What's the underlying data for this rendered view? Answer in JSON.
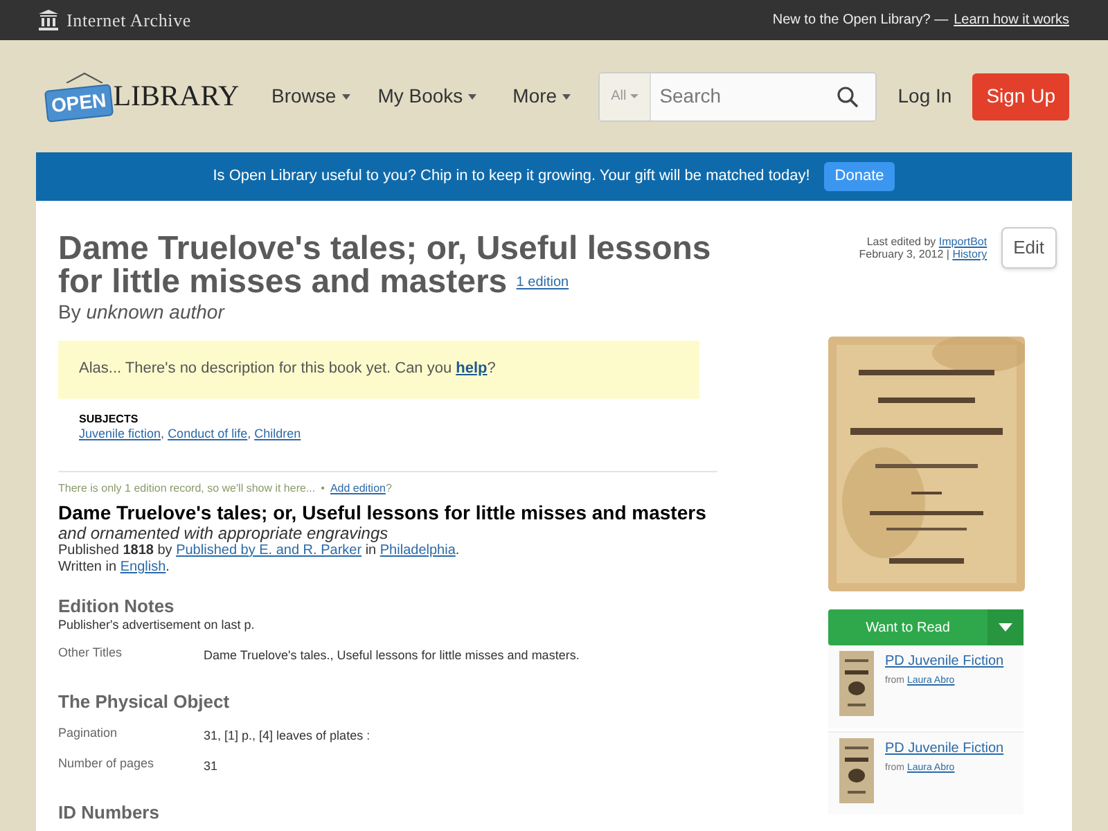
{
  "top_bar": {
    "brand": "Internet Archive",
    "prompt": "New to the Open Library? —",
    "link": "Learn how it works"
  },
  "header": {
    "logo": {
      "badge": "OPEN",
      "word": "LIBRARY"
    },
    "nav": [
      {
        "label": "Browse"
      },
      {
        "label": "My Books"
      },
      {
        "label": "More"
      }
    ],
    "search": {
      "scope": "All",
      "placeholder": "Search"
    },
    "login": "Log In",
    "signup": "Sign Up"
  },
  "banner": {
    "message": "Is Open Library useful to you? Chip in to keep it growing. Your gift will be matched today!",
    "button": "Donate"
  },
  "work": {
    "title": "Dame Truelove's tales; or, Useful lessons for little misses and masters",
    "editions_link": "1 edition",
    "by": "By",
    "author": "unknown author"
  },
  "edit_info": {
    "prefix": "Last edited by",
    "user": "ImportBot",
    "date": "February 3, 2012",
    "separator": "|",
    "history": "History",
    "button": "Edit"
  },
  "description": {
    "before": "Alas... There's no description for this book yet. Can you",
    "link": "help",
    "after": "?"
  },
  "subjects": {
    "heading": "SUBJECTS",
    "items": [
      "Juvenile fiction",
      "Conduct of life",
      "Children"
    ],
    "separator": ","
  },
  "edition_notice": {
    "text": "There is only 1 edition record, so we'll show it here...",
    "separator": "•",
    "link": "Add edition",
    "after": "?"
  },
  "edition": {
    "title": "Dame Truelove's tales; or, Useful lessons for little misses and masters",
    "subtitle": "and ornamented with appropriate engravings",
    "published": "Published",
    "year": "1818",
    "by": "by",
    "publisher": "Published by E. and R. Parker",
    "in": "in",
    "place": "Philadelphia",
    "end": ".",
    "written": "Written in",
    "language": "English"
  },
  "sections": [
    {
      "heading": "Edition Notes",
      "note": "Publisher's advertisement on last p.",
      "fields": [
        {
          "label": "Other Titles",
          "value": "Dame Truelove's tales., Useful lessons for little misses and masters."
        }
      ]
    },
    {
      "heading": "The Physical Object",
      "fields": [
        {
          "label": "Pagination",
          "value": "31, [1] p., [4] leaves of plates :"
        },
        {
          "label": "Number of pages",
          "value": "31"
        }
      ]
    },
    {
      "heading": "ID Numbers"
    }
  ],
  "sidebar": {
    "want_to_read": "Want to Read",
    "lists": [
      {
        "title": "PD Juvenile Fiction",
        "from": "from",
        "owner": "Laura Abro"
      },
      {
        "title": "PD Juvenile Fiction",
        "from": "from",
        "owner": "Laura Abro"
      }
    ]
  }
}
